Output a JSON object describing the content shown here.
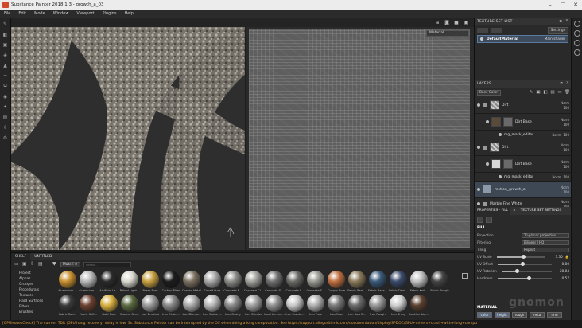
{
  "window": {
    "title": "Substance Painter 2018.1.3 - growth_a_03"
  },
  "menu": [
    "File",
    "Edit",
    "Mode",
    "Window",
    "Viewport",
    "Plugins",
    "Help"
  ],
  "viewport": {
    "material_mode": "Material"
  },
  "texture_set_list": {
    "title": "TEXTURE SET LIST",
    "settings_label": "Settings",
    "item_name": "DefaultMaterial",
    "item_shader": "Main shader"
  },
  "layers": {
    "title": "LAYERS",
    "channel": "Base Color",
    "items": [
      {
        "name": "Dirt",
        "blend": "Norm",
        "opacity": "100"
      },
      {
        "name": "Dirt Base",
        "blend": "Norm",
        "opacity": "100"
      },
      {
        "name": "mg_mask_editor",
        "blend": "Norm",
        "opacity": "100"
      },
      {
        "name": "Dirt",
        "blend": "Norm",
        "opacity": "100"
      },
      {
        "name": "Dirt Base",
        "blend": "Norm",
        "opacity": "100"
      },
      {
        "name": "mg_mask_editor",
        "blend": "Norm",
        "opacity": "100"
      },
      {
        "name": "motion_growth_a",
        "blend": "Norm",
        "opacity": "100"
      },
      {
        "name": "Marble Fine White",
        "blend": "Norm",
        "opacity": "100"
      }
    ]
  },
  "properties": {
    "tab_fill": "PROPERTIES - FILL",
    "tab_tss": "TEXTURE SET SETTINGS",
    "section": "FILL",
    "projection_label": "Projection",
    "projection_value": "Tri-planar projection",
    "filtering_label": "Filtering",
    "filtering_value": "Bilinear | HQ",
    "tiling_label": "Tiling",
    "tiling_value": "Repeat",
    "uv_scale_label": "UV Scale",
    "uv_scale_value": "3.30",
    "uv_offset_label": "UV Offset",
    "uv_offset_value": "0.00",
    "uv_rotation_label": "UV Rotation",
    "uv_rotation_value": "20.04",
    "hardness_label": "Hardness",
    "hardness_value": "0.57",
    "material_label": "MATERIAL",
    "material_buttons": [
      "color",
      "height",
      "rough",
      "metal",
      "nrm"
    ]
  },
  "shelf": {
    "tab_shelf": "SHELF",
    "tab_untitled": "UNTITLED",
    "filter_chip": "Materi",
    "search_placeholder": "Search...",
    "categories": [
      "Project",
      "Alphas",
      "Grunges",
      "Procedurals",
      "Textures",
      "Hard Surfaces",
      "Filters",
      "Brushes"
    ],
    "materials_row1": [
      {
        "label": "Aluminium ...",
        "color": "#c89030"
      },
      {
        "label": "Aluminium ...",
        "color": "#b8b8b8"
      },
      {
        "label": "Artificial Le...",
        "color": "#2a2a2a"
      },
      {
        "label": "Baked Light...",
        "color": "#d8d8d0"
      },
      {
        "label": "Brass Pure",
        "color": "#c8a040"
      },
      {
        "label": "Carbon Fiber",
        "color": "#1c1c1c"
      },
      {
        "label": "Coated Metal",
        "color": "#7a7060"
      },
      {
        "label": "Cobalt Pure",
        "color": "#a8a8a8"
      },
      {
        "label": "Concrete B...",
        "color": "#8a8a86"
      },
      {
        "label": "Concrete Cl...",
        "color": "#a0a09c"
      },
      {
        "label": "Concrete D...",
        "color": "#707070"
      },
      {
        "label": "Concrete S...",
        "color": "#6a6a66"
      },
      {
        "label": "Concrete S...",
        "color": "#9a9a94"
      },
      {
        "label": "Copper Pure",
        "color": "#c07040"
      },
      {
        "label": "Fabric Bam...",
        "color": "#8a7a5a"
      },
      {
        "label": "Fabric Base...",
        "color": "#3a5a7a"
      },
      {
        "label": "Fabric Deni...",
        "color": "#3a4a6a"
      },
      {
        "label": "Fabric Knit...",
        "color": "#c0c0c0"
      },
      {
        "label": "Fabric Rough",
        "color": "#444444"
      }
    ],
    "materials_row2": [
      {
        "label": "Fabric Rou...",
        "color": "#3a3a3a"
      },
      {
        "label": "Fabric Soft...",
        "color": "#6a4030"
      },
      {
        "label": "Gold Pure",
        "color": "#d8b040"
      },
      {
        "label": "Ground Gra...",
        "color": "#5a6a40"
      },
      {
        "label": "Iron Brushed",
        "color": "#9a9a9a"
      },
      {
        "label": "Iron Chain...",
        "color": "#888888"
      },
      {
        "label": "Iron Diamo...",
        "color": "#aaaaaa"
      },
      {
        "label": "Iron Galvan...",
        "color": "#b8b8b8"
      },
      {
        "label": "Iron Grainy",
        "color": "#8a8a8a"
      },
      {
        "label": "Iron Grinded",
        "color": "#a0a0a0"
      },
      {
        "label": "Iron Hamme...",
        "color": "#909090"
      },
      {
        "label": "Iron Powde...",
        "color": "#c8c8c8"
      },
      {
        "label": "Iron Pure",
        "color": "#b0b0b0"
      },
      {
        "label": "Iron Raw",
        "color": "#7a7a7a"
      },
      {
        "label": "Iron Raw D...",
        "color": "#6a6a6a"
      },
      {
        "label": "Iron Rough",
        "color": "#989898"
      },
      {
        "label": "Iron Shiny",
        "color": "#d0d0d0"
      },
      {
        "label": "Leather big...",
        "color": "#5a4030"
      }
    ]
  },
  "status": "[GPUIssuesCheck] The current TDR (GPU hang recovery) delay is low: 3s. Substance Painter can be interrupted by the OS when doing a long computation. See https://support.allegorithmic.com/documentation/display/SPDOC/GPU+drivers+crash+with+long+compu",
  "watermark": "gnomon"
}
